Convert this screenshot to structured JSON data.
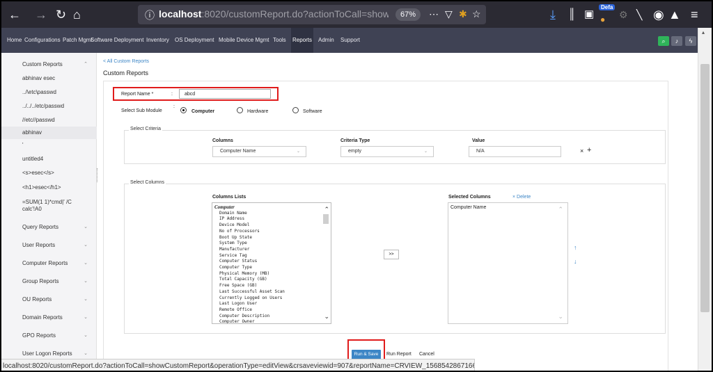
{
  "browser": {
    "url_host": "localhost",
    "url_rest": ":8020/customReport.do?actionToCall=showCustomRepor",
    "zoom": "67%",
    "profile_badge": "Defa"
  },
  "nav": {
    "items": [
      "Home",
      "Configurations",
      "Patch Mgmt",
      "Software Deployment",
      "Inventory",
      "OS Deployment",
      "Mobile Device Mgmt",
      "Tools",
      "Reports",
      "Admin",
      "Support"
    ],
    "active": "Reports"
  },
  "sidebar": {
    "header": "Custom Reports",
    "entries": [
      "abhinav esec",
      "../\\etc\\passwd",
      "../../../etc/passwd",
      "//etc//passwd",
      "abhinav",
      "'",
      "untitled4",
      "<s>esec</s>",
      "<h1>esec</h1>",
      "=SUM(1 1)*cmd|' /C",
      "calc'!A0"
    ],
    "sections": [
      "Query Reports",
      "User Reports",
      "Computer Reports",
      "Group Reports",
      "OU Reports",
      "Domain Reports",
      "GPO Reports",
      "User Logon Reports"
    ]
  },
  "main": {
    "back_link": "< All Custom Reports",
    "title": "Custom Reports",
    "report_name_label": "Report Name *",
    "report_name_value": "abcd",
    "sub_module_label": "Select Sub Module",
    "sub_modules": [
      "Computer",
      "Hardware",
      "Software"
    ],
    "criteria": {
      "legend": "Select Criteria",
      "columns_header": "Columns",
      "criteria_header": "Criteria Type",
      "value_header": "Value",
      "column_value": "Computer Name",
      "criteria_value": "empty",
      "value_value": "N/A"
    },
    "columns": {
      "legend": "Select Columns",
      "list_header": "Columns Lists",
      "selected_header": "Selected Columns",
      "delete_label": "Delete",
      "group": "Computer",
      "items": [
        "Domain Name",
        "IP Address",
        "Device Model",
        "No of Processors",
        "Boot Up State",
        "System Type",
        "Manufacturer",
        "Service Tag",
        "Computer Status",
        "Computer Type",
        "Physical Memory (MB)",
        "Total Capacity (GB)",
        "Free Space (GB)",
        "Last Successful Asset Scan",
        "Currently Logged on Users",
        "Last Logon User",
        "Remote Office",
        "Computer Description",
        "Computer Owner"
      ],
      "selected": [
        "Computer Name"
      ],
      "move_label": ">>"
    },
    "buttons": {
      "run_save": "Run & Save",
      "run_report": "Run Report",
      "cancel": "Cancel"
    }
  },
  "status_url": "localhost:8020/customReport.do?actionToCall=showCustomReport&operationType=editView&crsaveviewid=907&reportName=CRVIEW_1568542867166",
  "colors": {
    "accent": "#3d86c6",
    "highlight": "#e01b1b",
    "nav_bg": "#3f4254"
  }
}
